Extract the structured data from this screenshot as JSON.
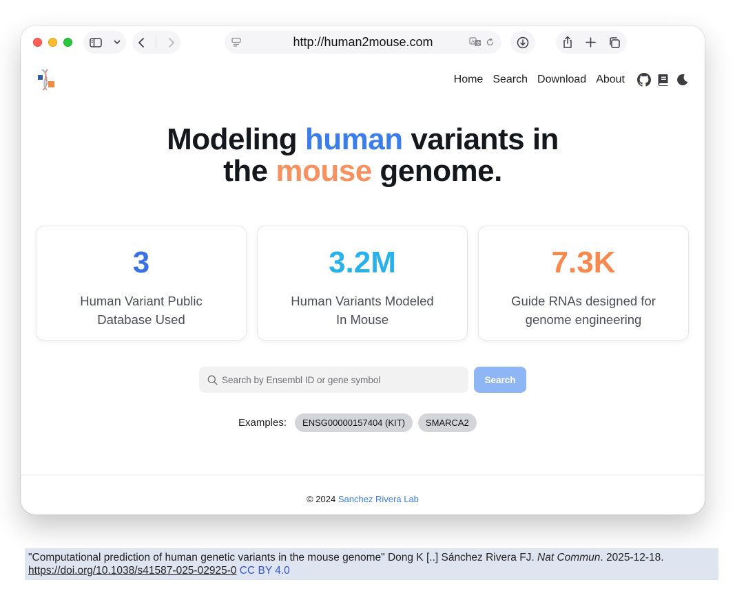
{
  "browser": {
    "url": "http://human2mouse.com"
  },
  "site": {
    "nav": [
      "Home",
      "Search",
      "Download",
      "About"
    ],
    "icons": [
      "github-icon",
      "book-icon",
      "moon-icon"
    ]
  },
  "hero": {
    "part1": "Modeling ",
    "highlight1": "human",
    "part2": " variants in",
    "part3": "the ",
    "highlight2": "mouse",
    "part4": " genome.",
    "colors": {
      "human": "#3b7de9",
      "mouse": "#f79260"
    }
  },
  "stats": [
    {
      "value": "3",
      "label": "Human Variant Public Database Used",
      "color": "#3b72e3"
    },
    {
      "value": "3.2M",
      "label": "Human Variants Modeled In Mouse",
      "color": "#29b1ea"
    },
    {
      "value": "7.3K",
      "label": "Guide RNAs designed for genome engineering",
      "color": "#f7894f"
    }
  ],
  "search": {
    "placeholder": "Search by Ensembl ID or gene symbol",
    "value": "",
    "button": "Search"
  },
  "examples": {
    "label": "Examples:",
    "items": [
      "ENSG00000157404 (KIT)",
      "SMARCA2"
    ]
  },
  "footer": {
    "copyright": "© 2024 ",
    "lab": "Sanchez Rivera Lab"
  },
  "citation": {
    "text_pre": "\"Computational prediction of human genetic variants in the mouse genome\" Dong K [..] Sánchez Rivera FJ. ",
    "journal": "Nat Commun",
    "text_post": ". 2025-12-18.",
    "doi": "https://doi.org/10.1038/s41587-025-02925-0",
    "license": "CC BY 4.0"
  }
}
